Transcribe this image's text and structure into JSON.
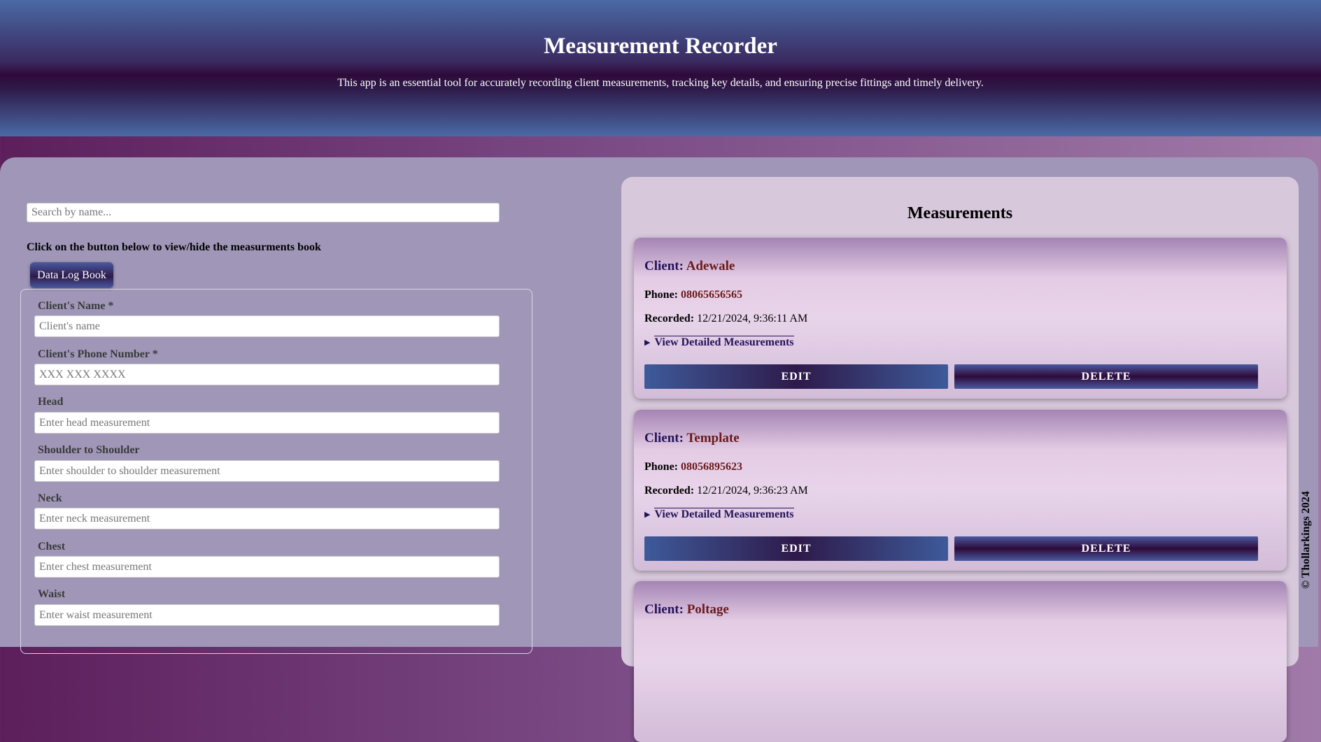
{
  "header": {
    "title": "Measurement Recorder",
    "subtitle": "This app is an essential tool for accurately recording client measurements, tracking key details, and ensuring precise fittings and timely delivery."
  },
  "search": {
    "placeholder": "Search by name..."
  },
  "toggle": {
    "label": "Click on the button below to view/hide the measurments book",
    "button": "Data Log Book"
  },
  "form": {
    "fields": [
      {
        "label": "Client's Name *",
        "placeholder": "Client's name"
      },
      {
        "label": "Client's Phone Number *",
        "placeholder": "XXX XXX XXXX"
      },
      {
        "label": "Head",
        "placeholder": "Enter head measurement"
      },
      {
        "label": "Shoulder to Shoulder",
        "placeholder": "Enter shoulder to shoulder measurement"
      },
      {
        "label": "Neck",
        "placeholder": "Enter neck measurement"
      },
      {
        "label": "Chest",
        "placeholder": "Enter chest measurement"
      },
      {
        "label": "Waist",
        "placeholder": "Enter waist measurement"
      }
    ]
  },
  "measurements": {
    "title": "Measurements",
    "client_key": "Client:",
    "phone_key": "Phone:",
    "recorded_key": "Recorded:",
    "view_label": "View Detailed Measurements",
    "edit_label": "EDIT",
    "delete_label": "DELETE",
    "cards": [
      {
        "client": "Adewale",
        "phone": "08065656565",
        "recorded": "12/21/2024, 9:36:11 AM"
      },
      {
        "client": "Template",
        "phone": "08056895623",
        "recorded": "12/21/2024, 9:36:23 AM"
      },
      {
        "client": "Poltage"
      }
    ]
  },
  "footer": {
    "copyright": "© Thollarkings 2024"
  },
  "colors": {
    "header_dark": "#2e0a3a",
    "header_blue": "#4a6aa5",
    "main_bg": "#a097b8",
    "panel_bg": "#d8c8dc",
    "client_value": "#6a1a1a",
    "link_navy": "#24125a"
  }
}
